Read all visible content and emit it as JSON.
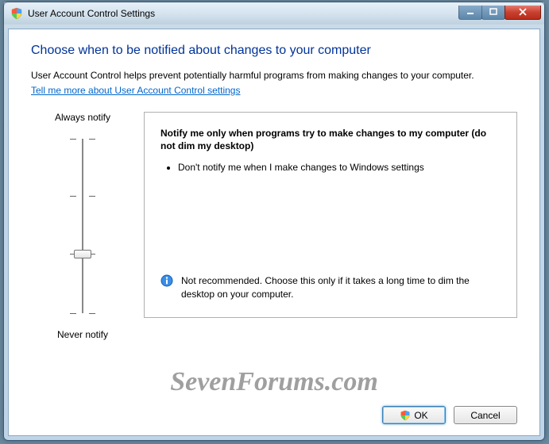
{
  "titlebar": {
    "title": "User Account Control Settings"
  },
  "content": {
    "heading": "Choose when to be notified about changes to your computer",
    "intro": "User Account Control helps prevent potentially harmful programs from making changes to your computer.",
    "link": "Tell me more about User Account Control settings"
  },
  "slider": {
    "top_label": "Always notify",
    "bottom_label": "Never notify",
    "levels": 4,
    "current_level": 1
  },
  "description": {
    "title": "Notify me only when programs try to make changes to my computer (do not dim my desktop)",
    "bullet": "Don't notify me when I make changes to Windows settings",
    "warning": "Not recommended. Choose this only if it takes a long time to dim the desktop on your computer."
  },
  "buttons": {
    "ok": "OK",
    "cancel": "Cancel"
  },
  "watermark": "SevenForums.com"
}
